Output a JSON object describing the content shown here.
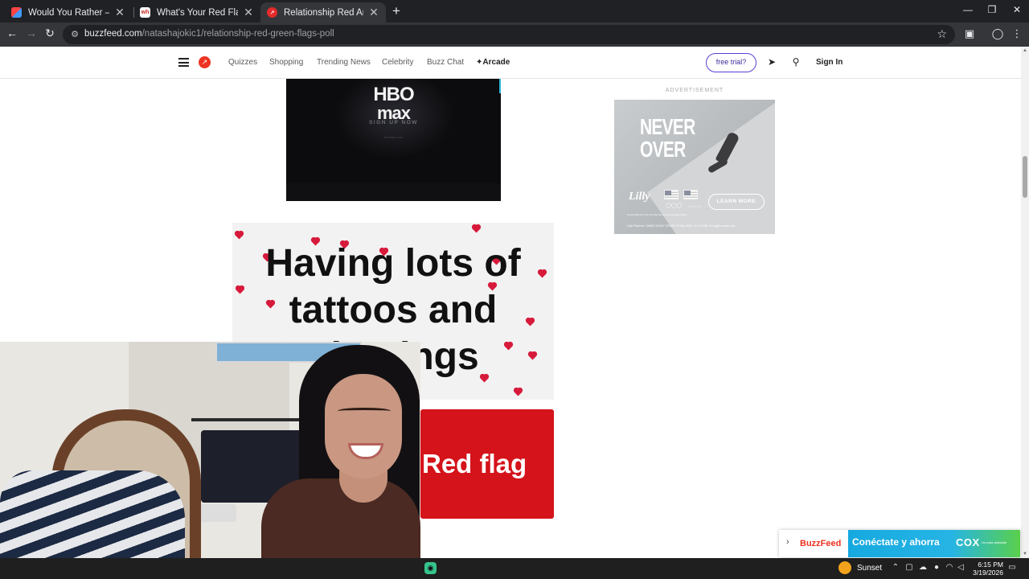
{
  "browser": {
    "tabs": [
      {
        "title": "Would You Rather — Play the Game",
        "favicon_color": "#5b6cf0",
        "active": false
      },
      {
        "title": "What's Your Red Flag Quiz - with",
        "favicon_color": "#ffffff",
        "active": false
      },
      {
        "title": "Relationship Red And Green Flags",
        "favicon_color": "#e32b2b",
        "active": true
      }
    ],
    "new_tab": "+",
    "url_host": "buzzfeed.com",
    "url_path": "/natashajokic1/relationship-red-green-flags-poll",
    "window_controls": [
      "—",
      "❐",
      "✕"
    ]
  },
  "header": {
    "nav_links": [
      "Quizzes",
      "Shopping",
      "Trending News",
      "Celebrity",
      "Buzz Chat"
    ],
    "arcade": "Arcade",
    "free_trial": "free trial?",
    "sign_in": "Sign In"
  },
  "hbo_ad": {
    "logo_top": "HBO",
    "logo_bottom": "max",
    "cta": "SIGN UP NOW",
    "fine_print": "hbomax.com"
  },
  "sidebar_ad": {
    "label": "ADVERTISEMENT",
    "headline": [
      "NEVER",
      "OVER"
    ],
    "brand": "Lilly",
    "learn_more": "LEARN MORE",
    "tagline": "Proud Partner of the US Olympic and Paralympic Teams",
    "legal": "Lilly Partner: OMAT-01447 2/2026 ©Lilly USA, LLC 2026. All rights reserved."
  },
  "quiz": {
    "question_lines": [
      "Having lots of",
      "tattoos and",
      "piercings"
    ],
    "answer_label": "Red flag"
  },
  "bottom_banner": {
    "buzzfeed": "BuzzFeed",
    "headline": "Conéctate y ahorra",
    "brand": "COX",
    "small": "Un paso adelante"
  },
  "taskbar": {
    "weather": "Sunset",
    "time": "6:15 PM",
    "date": "3/19/2026"
  },
  "colors": {
    "brand_red": "#e32b2b",
    "answer_red": "#d4131a",
    "free_trial_purple": "#5b3fd6"
  }
}
